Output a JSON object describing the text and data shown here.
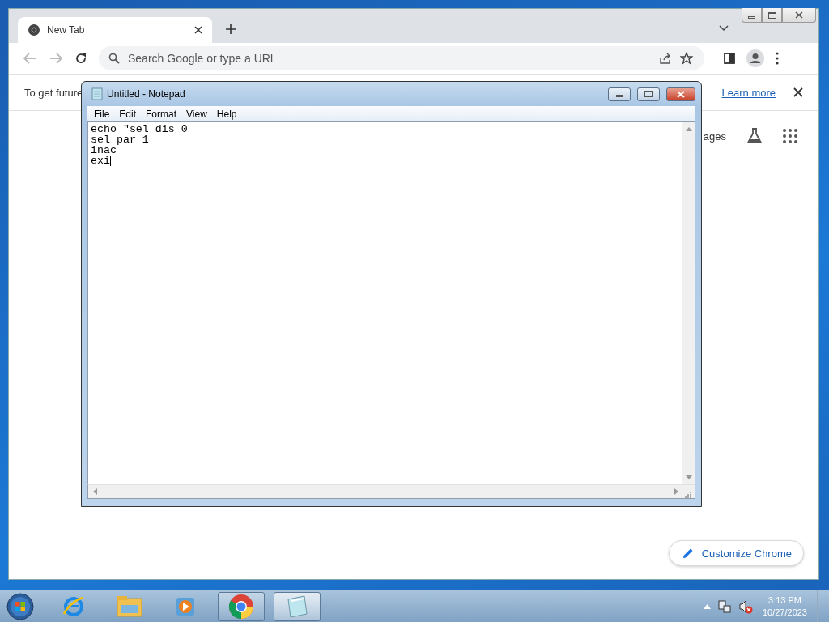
{
  "browser": {
    "tabs": [
      {
        "title": "New Tab",
        "selected": true
      }
    ],
    "address_bar": {
      "placeholder": "Search Google or type a URL"
    },
    "infobar": {
      "message": "To get future",
      "link": "Learn more"
    },
    "page": {
      "partial_link": "ages",
      "customize_button": "Customize Chrome"
    }
  },
  "notepad": {
    "title": "Untitled - Notepad",
    "menu": [
      "File",
      "Edit",
      "Format",
      "View",
      "Help"
    ],
    "text_lines": [
      "echo \"sel dis 0",
      "sel par 1",
      "inac",
      "exi"
    ]
  },
  "taskbar": {
    "apps": [
      {
        "kind": "ie",
        "running": false,
        "selected": false
      },
      {
        "kind": "explorer",
        "running": false,
        "selected": false
      },
      {
        "kind": "media",
        "running": false,
        "selected": false
      },
      {
        "kind": "chrome",
        "running": true,
        "selected": false
      },
      {
        "kind": "notepad",
        "running": true,
        "selected": true
      }
    ],
    "clock": {
      "time": "3:13 PM",
      "date": "10/27/2023"
    }
  }
}
